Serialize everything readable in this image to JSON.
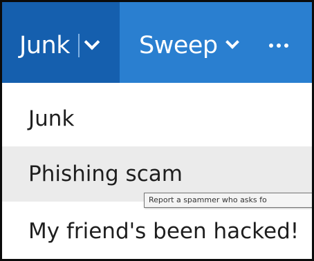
{
  "toolbar": {
    "junk_label": "Junk",
    "sweep_label": "Sweep",
    "more_icon": "ellipsis-icon",
    "colors": {
      "bar": "#2a7fd0",
      "junk_button": "#155fae",
      "text": "#ffffff"
    }
  },
  "menu": {
    "items": [
      {
        "label": "Junk"
      },
      {
        "label": "Phishing scam"
      },
      {
        "label": "My friend's been hacked!"
      }
    ],
    "hover_background": "#ebebeb"
  },
  "tooltip": {
    "text": "Report a spammer who asks fo"
  }
}
